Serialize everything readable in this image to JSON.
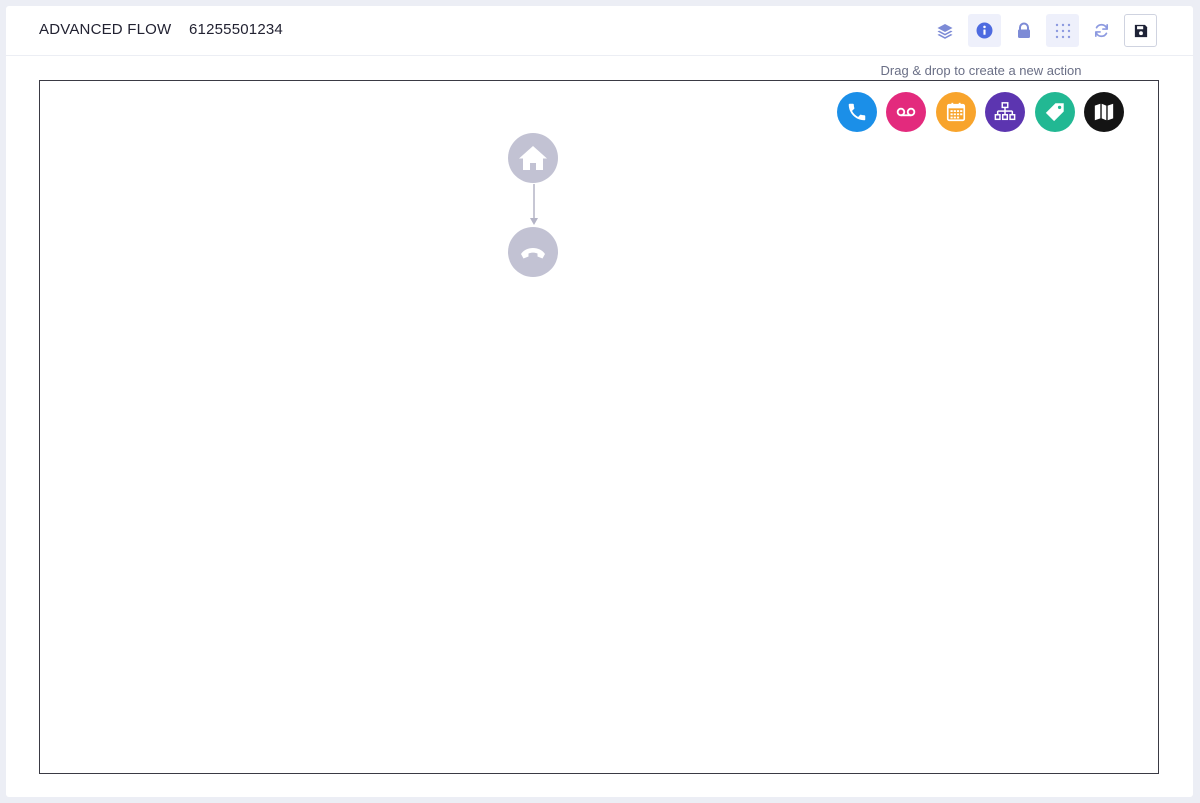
{
  "header": {
    "title": "ADVANCED FLOW",
    "phone_number": "61255501234"
  },
  "toolbar": {
    "buttons": [
      {
        "icon": "layers-icon",
        "state": "normal"
      },
      {
        "icon": "info-icon",
        "state": "active"
      },
      {
        "icon": "lock-icon",
        "state": "normal"
      },
      {
        "icon": "grid-icon",
        "state": "active"
      },
      {
        "icon": "refresh-icon",
        "state": "normal"
      },
      {
        "icon": "save-icon",
        "state": "outlined"
      }
    ],
    "icon_color": "#7d8bd6"
  },
  "palette": {
    "hint": "Drag & drop to create a new action",
    "actions": [
      {
        "icon": "phone-icon",
        "color": "#1b8fe8"
      },
      {
        "icon": "voicemail-icon",
        "color": "#e32a7d"
      },
      {
        "icon": "calendar-icon",
        "color": "#f8a42c"
      },
      {
        "icon": "org-chart-icon",
        "color": "#5c35b0"
      },
      {
        "icon": "tag-icon",
        "color": "#22b893"
      },
      {
        "icon": "map-icon",
        "color": "#141414"
      }
    ]
  },
  "flow": {
    "nodes": [
      {
        "icon": "home-icon",
        "type": "start"
      },
      {
        "icon": "hangup-icon",
        "type": "end"
      }
    ],
    "node_color": "#c2c2d3"
  }
}
